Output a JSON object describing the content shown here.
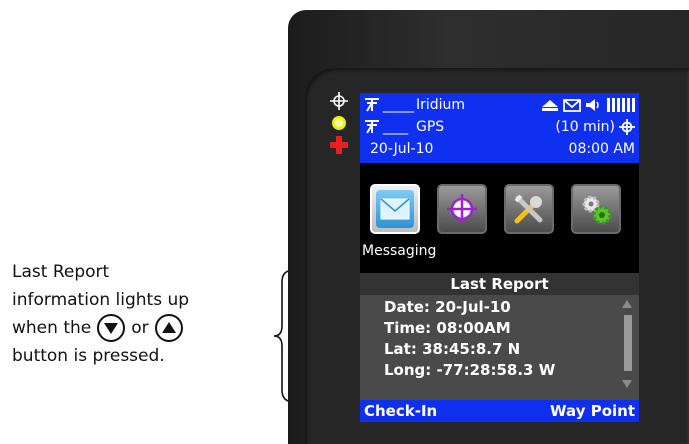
{
  "annotation": {
    "line1": "Last Report",
    "line2": "information lights up",
    "line3_pre": "when the",
    "line3_mid": "or",
    "line4": "button is pressed."
  },
  "status": {
    "iridium_dashes": "_____",
    "iridium_label": "Iridium",
    "gps_dashes": "____",
    "gps_label": "GPS",
    "interval": "(10 min)",
    "date": "20-Jul-10",
    "time": "08:00 AM"
  },
  "menu": {
    "selected_label": "Messaging",
    "icons": [
      "envelope-icon",
      "crosshair-icon",
      "tools-icon",
      "gears-icon"
    ]
  },
  "report": {
    "title": "Last Report",
    "date": "Date: 20-Jul-10",
    "time": "Time: 08:00AM",
    "lat": "Lat: 38:45:8.7 N",
    "long": "Long: -77:28:58.3 W"
  },
  "softkeys": {
    "left": "Check-In",
    "right": "Way Point"
  },
  "colors": {
    "screen_blue": "#1030f0",
    "indicator_yellow": "#e8f020",
    "indicator_red": "#e82020",
    "crosshair_purple": "#a020d0"
  }
}
